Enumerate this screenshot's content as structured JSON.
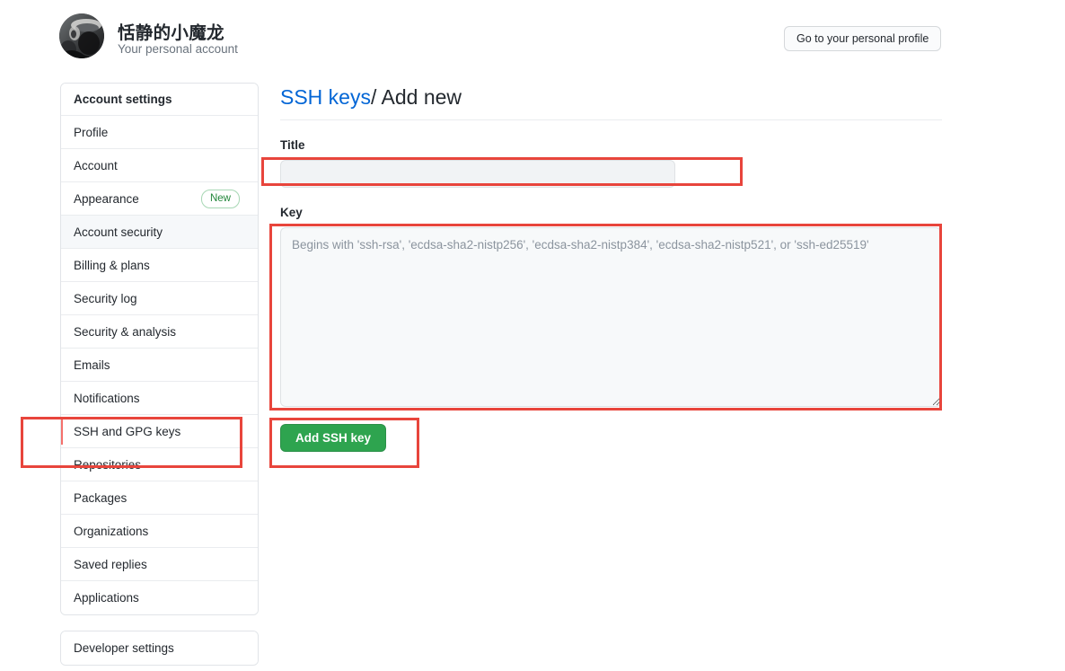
{
  "header": {
    "account_name": "恬静的小魔龙",
    "subtitle": "Your personal account",
    "profile_button": "Go to your personal profile",
    "avatar_icon": "user-photo-avatar"
  },
  "sidebar": {
    "card_header": "Account settings",
    "items": [
      {
        "label": "Profile",
        "badge": null,
        "state": "normal"
      },
      {
        "label": "Account",
        "badge": null,
        "state": "normal"
      },
      {
        "label": "Appearance",
        "badge": "New",
        "state": "normal"
      },
      {
        "label": "Account security",
        "badge": null,
        "state": "current"
      },
      {
        "label": "Billing & plans",
        "badge": null,
        "state": "normal"
      },
      {
        "label": "Security log",
        "badge": null,
        "state": "normal"
      },
      {
        "label": "Security & analysis",
        "badge": null,
        "state": "normal"
      },
      {
        "label": "Emails",
        "badge": null,
        "state": "normal"
      },
      {
        "label": "Notifications",
        "badge": null,
        "state": "normal"
      },
      {
        "label": "SSH and GPG keys",
        "badge": null,
        "state": "selected"
      },
      {
        "label": "Repositories",
        "badge": null,
        "state": "normal"
      },
      {
        "label": "Packages",
        "badge": null,
        "state": "normal"
      },
      {
        "label": "Organizations",
        "badge": null,
        "state": "normal"
      },
      {
        "label": "Saved replies",
        "badge": null,
        "state": "normal"
      },
      {
        "label": "Applications",
        "badge": null,
        "state": "normal"
      }
    ],
    "developer_settings": "Developer settings"
  },
  "main": {
    "breadcrumb": {
      "link": "SSH keys",
      "separator": "/",
      "current": "Add new"
    },
    "title_field": {
      "label": "Title",
      "value": "",
      "placeholder": ""
    },
    "key_field": {
      "label": "Key",
      "value": "",
      "placeholder": "Begins with 'ssh-rsa', 'ecdsa-sha2-nistp256', 'ecdsa-sha2-nistp384', 'ecdsa-sha2-nistp521', or 'ssh-ed25519'"
    },
    "submit_button": "Add SSH key"
  },
  "colors": {
    "accent_link": "#0366d6",
    "button_green": "#2ea44f",
    "badge_green": "#22863a",
    "annotation_red": "#e8453c",
    "selected_bar": "#f5706b",
    "current_row_bg": "#f6f8fa"
  }
}
